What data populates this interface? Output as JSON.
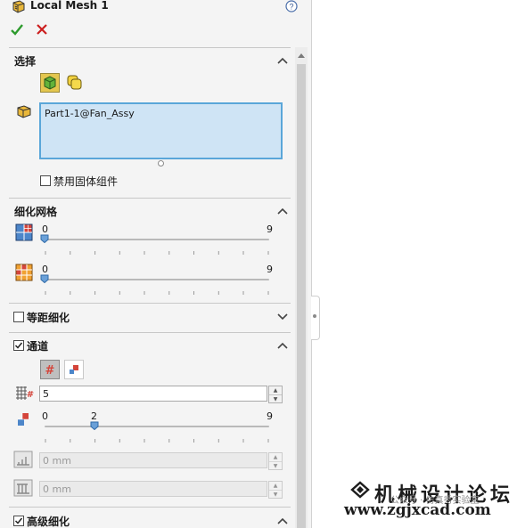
{
  "header": {
    "title": "Local Mesh 1",
    "help_icon": "help-circle-icon",
    "ok_icon": "checkmark-icon",
    "cancel_icon": "close-x-icon"
  },
  "selection": {
    "title": "选择",
    "selected_item": "Part1-1@Fan_Assy",
    "checkbox_label": "禁用固体组件",
    "checkbox_checked": false
  },
  "refine": {
    "title": "细化网格",
    "slider1": {
      "value": "0",
      "max": "9",
      "fraction": 0
    },
    "slider2": {
      "value": "0",
      "max": "9",
      "fraction": 0
    }
  },
  "equidistant": {
    "title": "等距细化",
    "checked": false
  },
  "channel": {
    "title": "通道",
    "checked": true,
    "count_value": "5",
    "slider": {
      "min": "0",
      "value": "2",
      "max": "9",
      "fraction": 0.2222
    },
    "field1_value": "0 mm",
    "field2_value": "0 mm"
  },
  "advanced": {
    "title": "高级细化",
    "checked": true
  },
  "watermark": {
    "title": "机械设计论坛",
    "url": "www.zgjxcad.com",
    "wechat": "公众号 · 仿真秀实验室"
  },
  "colors": {
    "accent": "#2f87c6",
    "selection_fill": "#cfe4f5",
    "ok_green": "#2e9b2e",
    "cancel_red": "#cc1f1f"
  }
}
